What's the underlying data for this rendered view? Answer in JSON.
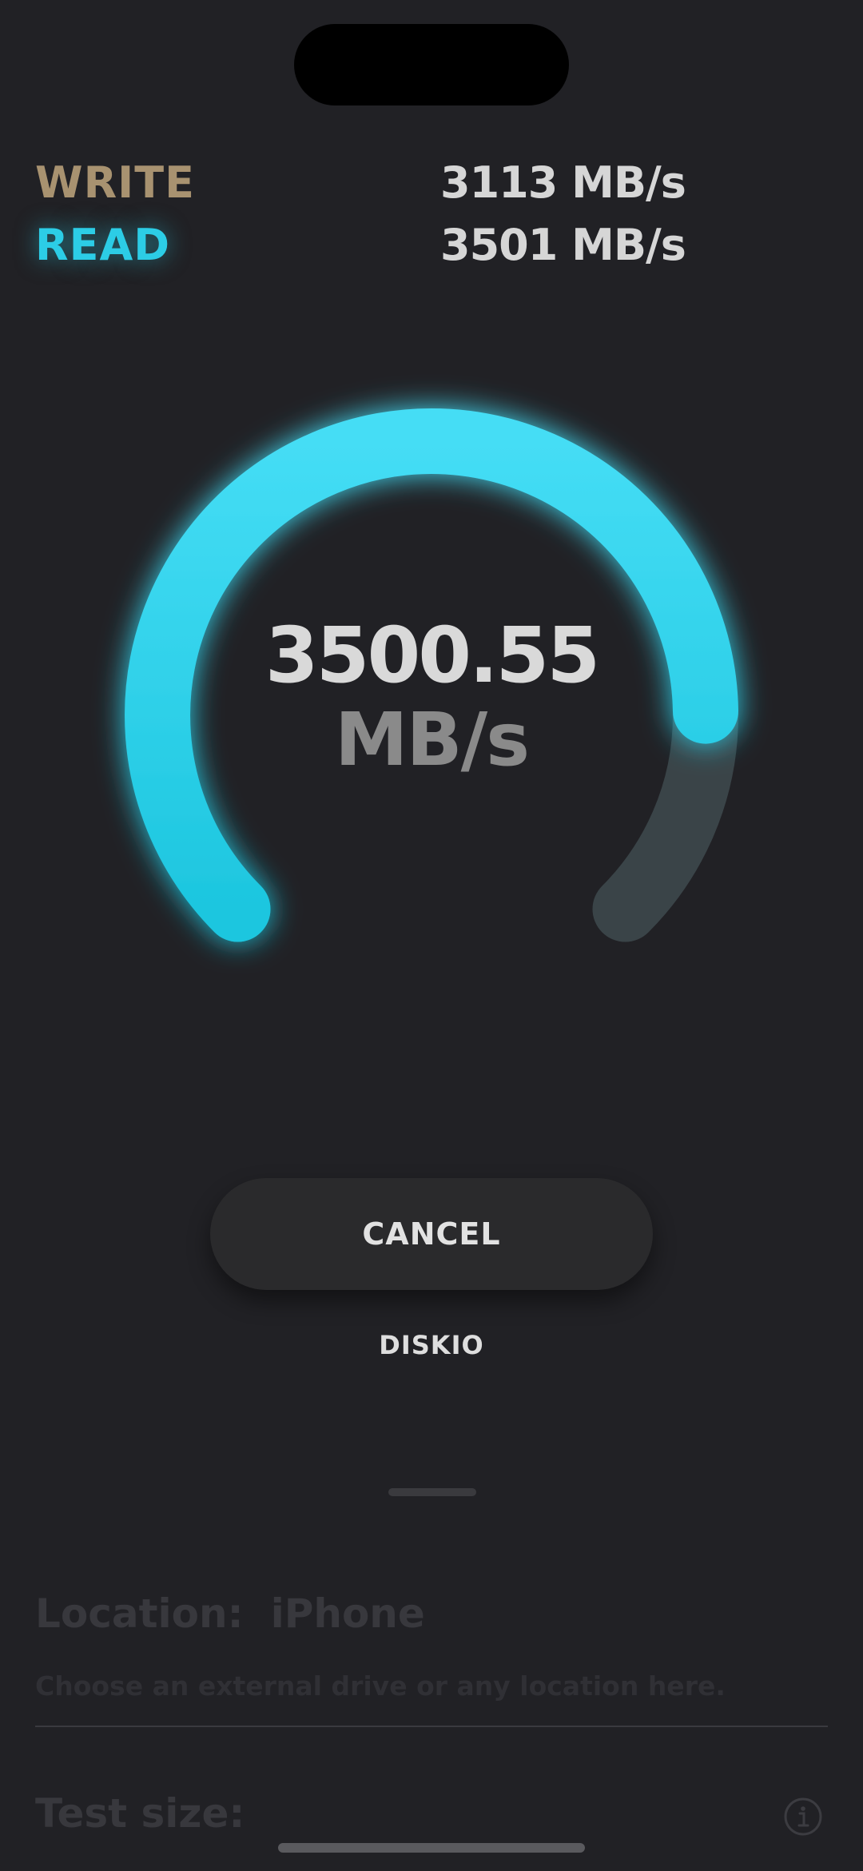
{
  "stats": {
    "write_label": "WRITE",
    "write_value": "3113 MB/s",
    "read_label": "READ",
    "read_value": "3501 MB/s"
  },
  "gauge": {
    "speed_value": "3500.55",
    "speed_unit": "MB/s",
    "progress_fraction": 0.83,
    "colors": {
      "active": "#2ccde6",
      "track": "#3a4448",
      "write": "#a89270"
    }
  },
  "actions": {
    "cancel_label": "CANCEL",
    "brand_label": "DISKIO"
  },
  "settings": {
    "location_label": "Location:",
    "location_value": "iPhone",
    "location_hint": "Choose an external drive or any location here.",
    "test_size_label": "Test size:",
    "info_icon": "info-icon"
  }
}
